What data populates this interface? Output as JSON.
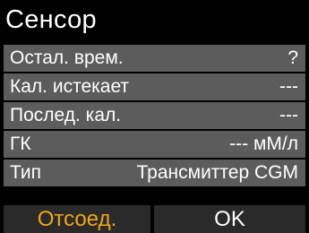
{
  "screen": {
    "title": "Сенсор"
  },
  "rows": [
    {
      "label": "Остал. врем.",
      "value": "?"
    },
    {
      "label": "Кал. истекает",
      "value": "---"
    },
    {
      "label": "Послед. кал.",
      "value": "---"
    },
    {
      "label": "ГК",
      "value": "--- мМ/л"
    },
    {
      "label": "Тип",
      "value": "Трансмиттер CGM"
    }
  ],
  "softkeys": {
    "left_label": "Отсоед.",
    "right_label": "OK"
  },
  "colors": {
    "background": "#000000",
    "row_background": "#5c5c5c",
    "softkey_background": "#2a2a2a",
    "selected_softkey_text": "#f2a417",
    "text": "#ffffff"
  }
}
